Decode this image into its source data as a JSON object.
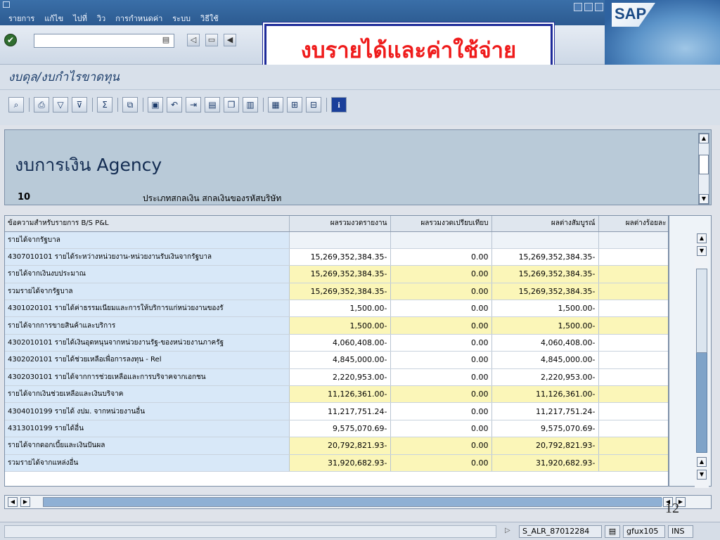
{
  "menu": [
    "รายการ",
    "แก้ไข",
    "ไปที่",
    "วิว",
    "การกำหนดค่า",
    "ระบบ",
    "วิธีใช้"
  ],
  "overlay_title": "งบรายได้และค่าใช้จ่าย",
  "page_title": "งบดุล/งบกำไรขาดทุน",
  "sap_logo": "SAP",
  "header": {
    "title": "งบการเงิน Agency",
    "code": "10",
    "description": "ประเภทสกลเงิน สกลเงินของรหัสบริษัท"
  },
  "table": {
    "columns": [
      "ข้อความสำหรับรายการ B/S P&L",
      "ผลรวมงวดรายงาน",
      "ผลรวมงวดเปรียบเทียบ",
      "ผลต่างสัมบูรณ์",
      "ผลต่างร้อยละ"
    ],
    "rows": [
      {
        "label": "รายได้จากรัฐบาล",
        "report": "",
        "compare": "",
        "absdiff": "",
        "pctdiff": "",
        "kind": "plain"
      },
      {
        "label": "4307010101 รายได้ระหว่างหน่วยงาน-หน่วยงานรับเงินจากรัฐบาล",
        "report": "15,269,352,384.35-",
        "compare": "0.00",
        "absdiff": "15,269,352,384.35-",
        "pctdiff": "",
        "kind": "detail"
      },
      {
        "label": "รายได้จากเงินงบประมาณ",
        "report": "15,269,352,384.35-",
        "compare": "0.00",
        "absdiff": "15,269,352,384.35-",
        "pctdiff": "",
        "kind": "subtotal"
      },
      {
        "label": "รวมรายได้จากรัฐบาล",
        "report": "15,269,352,384.35-",
        "compare": "0.00",
        "absdiff": "15,269,352,384.35-",
        "pctdiff": "",
        "kind": "subtotal"
      },
      {
        "label": "4301020101 รายได้ค่าธรรมเนียมและการให้บริการแก่หน่วยงานของรั",
        "report": "1,500.00-",
        "compare": "0.00",
        "absdiff": "1,500.00-",
        "pctdiff": "",
        "kind": "detail"
      },
      {
        "label": "รายได้จากการขายสินค้าและบริการ",
        "report": "1,500.00-",
        "compare": "0.00",
        "absdiff": "1,500.00-",
        "pctdiff": "",
        "kind": "subtotal"
      },
      {
        "label": "4302010101 รายได้เงินอุดหนุนจากหน่วยงานรัฐ-ของหน่วยงานภาครัฐ",
        "report": "4,060,408.00-",
        "compare": "0.00",
        "absdiff": "4,060,408.00-",
        "pctdiff": "",
        "kind": "detail"
      },
      {
        "label": "4302020101 รายได้ช่วยเหลือเพื่อการลงทุน - Rel",
        "report": "4,845,000.00-",
        "compare": "0.00",
        "absdiff": "4,845,000.00-",
        "pctdiff": "",
        "kind": "detail"
      },
      {
        "label": "4302030101 รายได้จากการช่วยเหลือและการบริจาคจากเอกชน",
        "report": "2,220,953.00-",
        "compare": "0.00",
        "absdiff": "2,220,953.00-",
        "pctdiff": "",
        "kind": "detail"
      },
      {
        "label": "รายได้จากเงินช่วยเหลือและเงินบริจาค",
        "report": "11,126,361.00-",
        "compare": "0.00",
        "absdiff": "11,126,361.00-",
        "pctdiff": "",
        "kind": "subtotal"
      },
      {
        "label": "4304010199 รายได้ งปม. จากหน่วยงานอื่น",
        "report": "11,217,751.24-",
        "compare": "0.00",
        "absdiff": "11,217,751.24-",
        "pctdiff": "",
        "kind": "detail"
      },
      {
        "label": "4313010199 รายได้อื่น",
        "report": "9,575,070.69-",
        "compare": "0.00",
        "absdiff": "9,575,070.69-",
        "pctdiff": "",
        "kind": "detail"
      },
      {
        "label": "รายได้จากดอกเบี้ยและเงินปันผล",
        "report": "20,792,821.93-",
        "compare": "0.00",
        "absdiff": "20,792,821.93-",
        "pctdiff": "",
        "kind": "subtotal"
      },
      {
        "label": "รวมรายได้จากแหล่งอื่น",
        "report": "31,920,682.93-",
        "compare": "0.00",
        "absdiff": "31,920,682.93-",
        "pctdiff": "",
        "kind": "subtotal"
      }
    ]
  },
  "page_number": "12",
  "status": {
    "system": "S_ALR_87012284",
    "client": "gfux105",
    "mode": "INS"
  }
}
